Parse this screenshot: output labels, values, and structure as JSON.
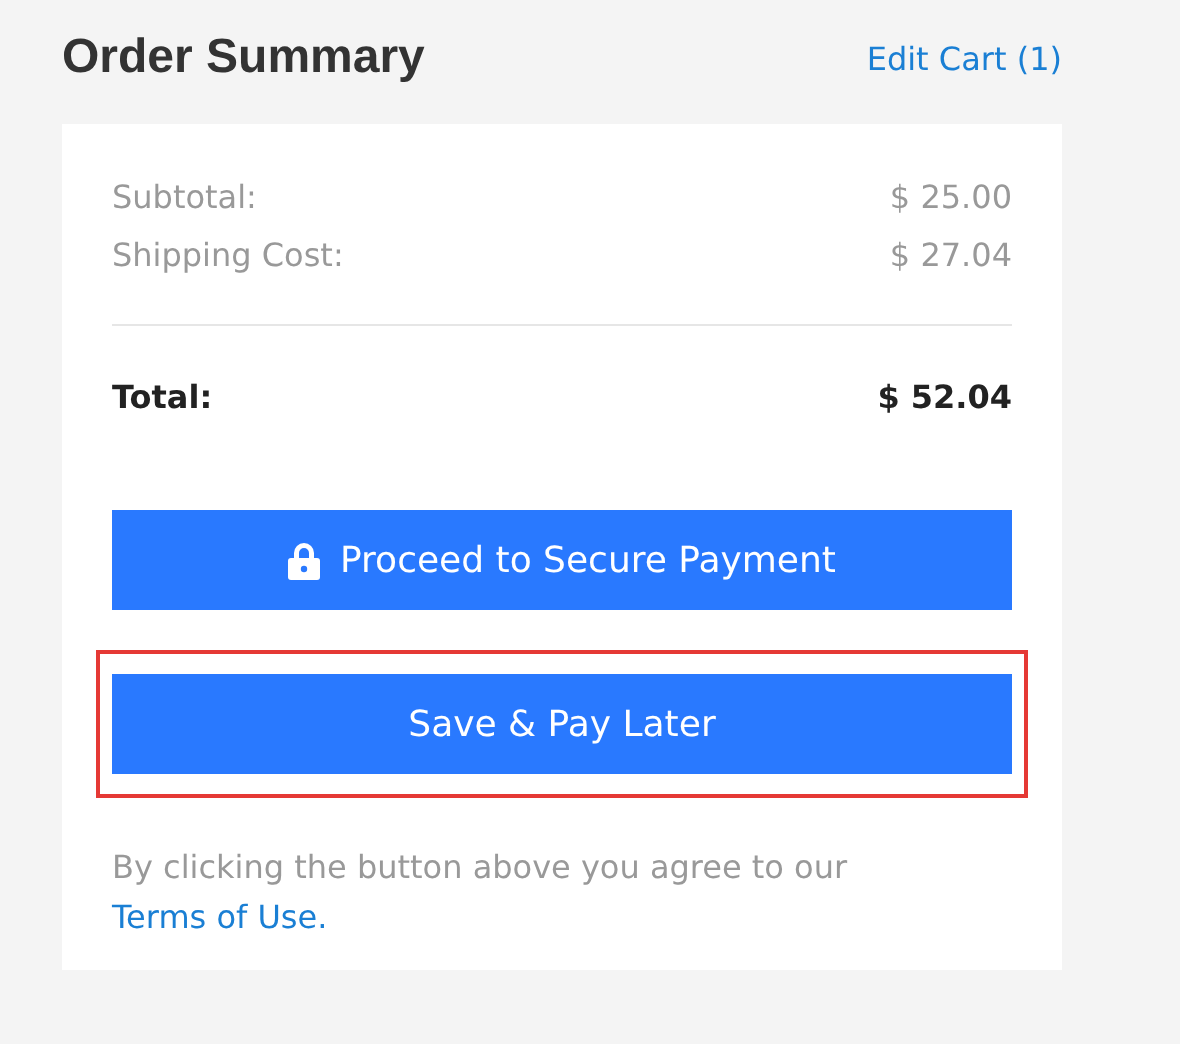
{
  "header": {
    "title": "Order Summary",
    "edit_link": "Edit Cart (1)"
  },
  "lines": [
    {
      "label": "Subtotal:",
      "amount": "$ 25.00",
      "kind": "regular"
    },
    {
      "label": "Shipping Cost:",
      "amount": "$ 27.04",
      "kind": "regular"
    },
    {
      "label": "Total:",
      "amount": "$ 52.04",
      "kind": "total"
    }
  ],
  "buttons": [
    {
      "label": "Proceed to Secure Payment",
      "kind": "lock",
      "highlighted": false
    },
    {
      "label": "Save & Pay Later",
      "kind": "plain",
      "highlighted": true
    }
  ],
  "agreement": {
    "text": "By clicking the button above you agree to our",
    "link": "Terms of Use."
  }
}
